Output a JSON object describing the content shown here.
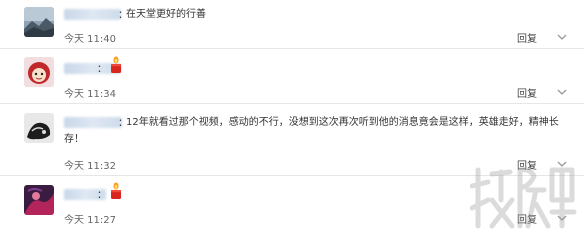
{
  "comments": [
    {
      "text": "在天堂更好的行善",
      "time": "今天 11:40",
      "reply_label": "回复",
      "avatar_icon": "avatar-mountain",
      "icon": "more-icon"
    },
    {
      "text": "",
      "time": "今天 11:34",
      "reply_label": "回复",
      "avatar_icon": "avatar-cartoon",
      "emoji": "candle-emoji-icon"
    },
    {
      "text": "12年就看过那个视频，感动的不行，没想到这次再次听到他的消息竟会是这样，英雄走好，精神长存！",
      "time": "今天 11:32",
      "reply_label": "回复",
      "avatar_icon": "avatar-dark"
    },
    {
      "text": "",
      "time": "今天 11:27",
      "reply_label": "回复",
      "avatar_icon": "avatar-purple",
      "emoji": "candle-emoji-icon"
    }
  ],
  "colon": "：",
  "colors": {
    "text": "#333333",
    "time": "#666666",
    "divider": "#e6e6e6",
    "username_blur": "#cddbeb"
  }
}
